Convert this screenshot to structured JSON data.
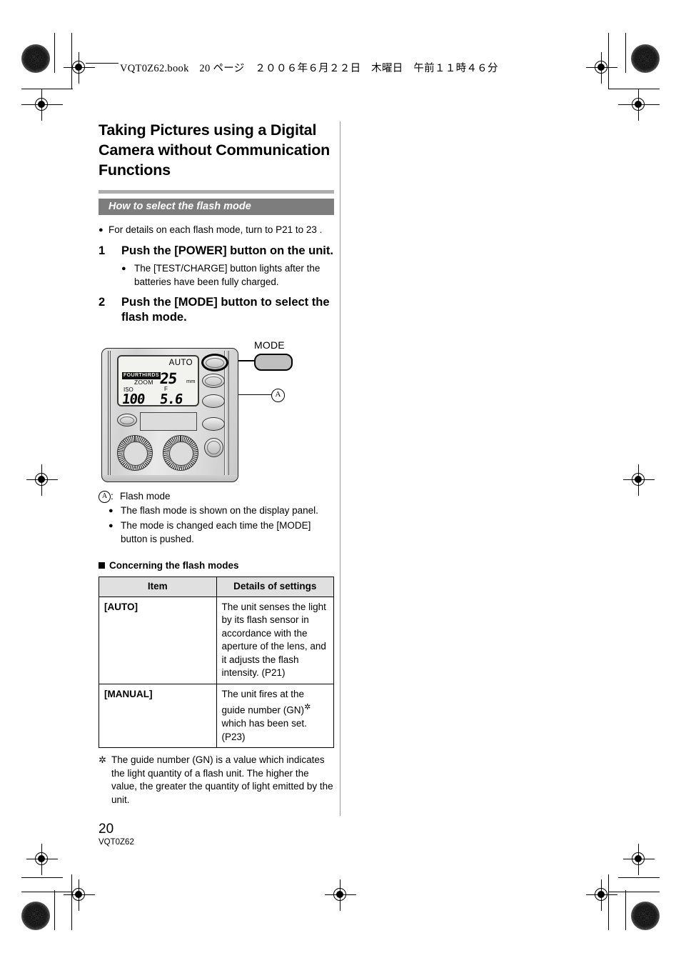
{
  "print_header": {
    "text": "VQT0Z62.book　20 ページ　２００６年６月２２日　木曜日　午前１１時４６分"
  },
  "document": {
    "title": "Taking Pictures using a Digital Camera without Communication Functions",
    "section_heading": "How to select the flash mode",
    "intro_bullet": "For details on each flash mode, turn to P21 to 23 .",
    "steps": [
      {
        "number": "1",
        "text": "Push the [POWER] button on the unit.",
        "substeps": [
          "The [TEST/CHARGE] button lights after the batteries have been fully charged."
        ]
      },
      {
        "number": "2",
        "text": "Push the [MODE] button to select the flash mode.",
        "substeps": []
      }
    ],
    "figure": {
      "mode_label": "MODE",
      "callout_marker": "A",
      "lcd": {
        "mode_indicator": "AUTO",
        "standard_badge": "FOURTHIRDS",
        "zoom_label": "ZOOM",
        "zoom_value": "25",
        "zoom_unit": "mm",
        "iso_label": "ISO",
        "iso_value": "100",
        "aperture_label": "F",
        "aperture_value": "5.6"
      }
    },
    "callout_legend": {
      "marker": "A",
      "colon": ":",
      "text": "Flash mode"
    },
    "figure_notes": [
      "The flash mode is shown on the display panel.",
      "The mode is changed each time the [MODE] button is pushed."
    ],
    "table_heading": "Concerning the flash modes",
    "table": {
      "headers": [
        "Item",
        "Details of settings"
      ],
      "rows": [
        {
          "item": "[AUTO]",
          "details": "The unit senses the light by its flash sensor in accordance with the aperture of the lens, and it adjusts the flash intensity. (P21)"
        },
        {
          "item": "[MANUAL]",
          "details_prefix": "The unit fires at the guide number (GN)",
          "details_suffix": " which has been set. (P23)"
        }
      ]
    },
    "footnote": {
      "marker": "✲",
      "text": "The guide number (GN) is a value which indicates the light quantity of a flash unit. The higher the value, the greater the quantity of light emitted by the unit."
    },
    "footer": {
      "page_number": "20",
      "doc_code": "VQT0Z62"
    }
  },
  "colors": {
    "section_bar": "#7d7d7d",
    "title_underbar": "#aeaeae",
    "table_header": "#e0e0e0",
    "column_rule": "#9b9b9b"
  }
}
